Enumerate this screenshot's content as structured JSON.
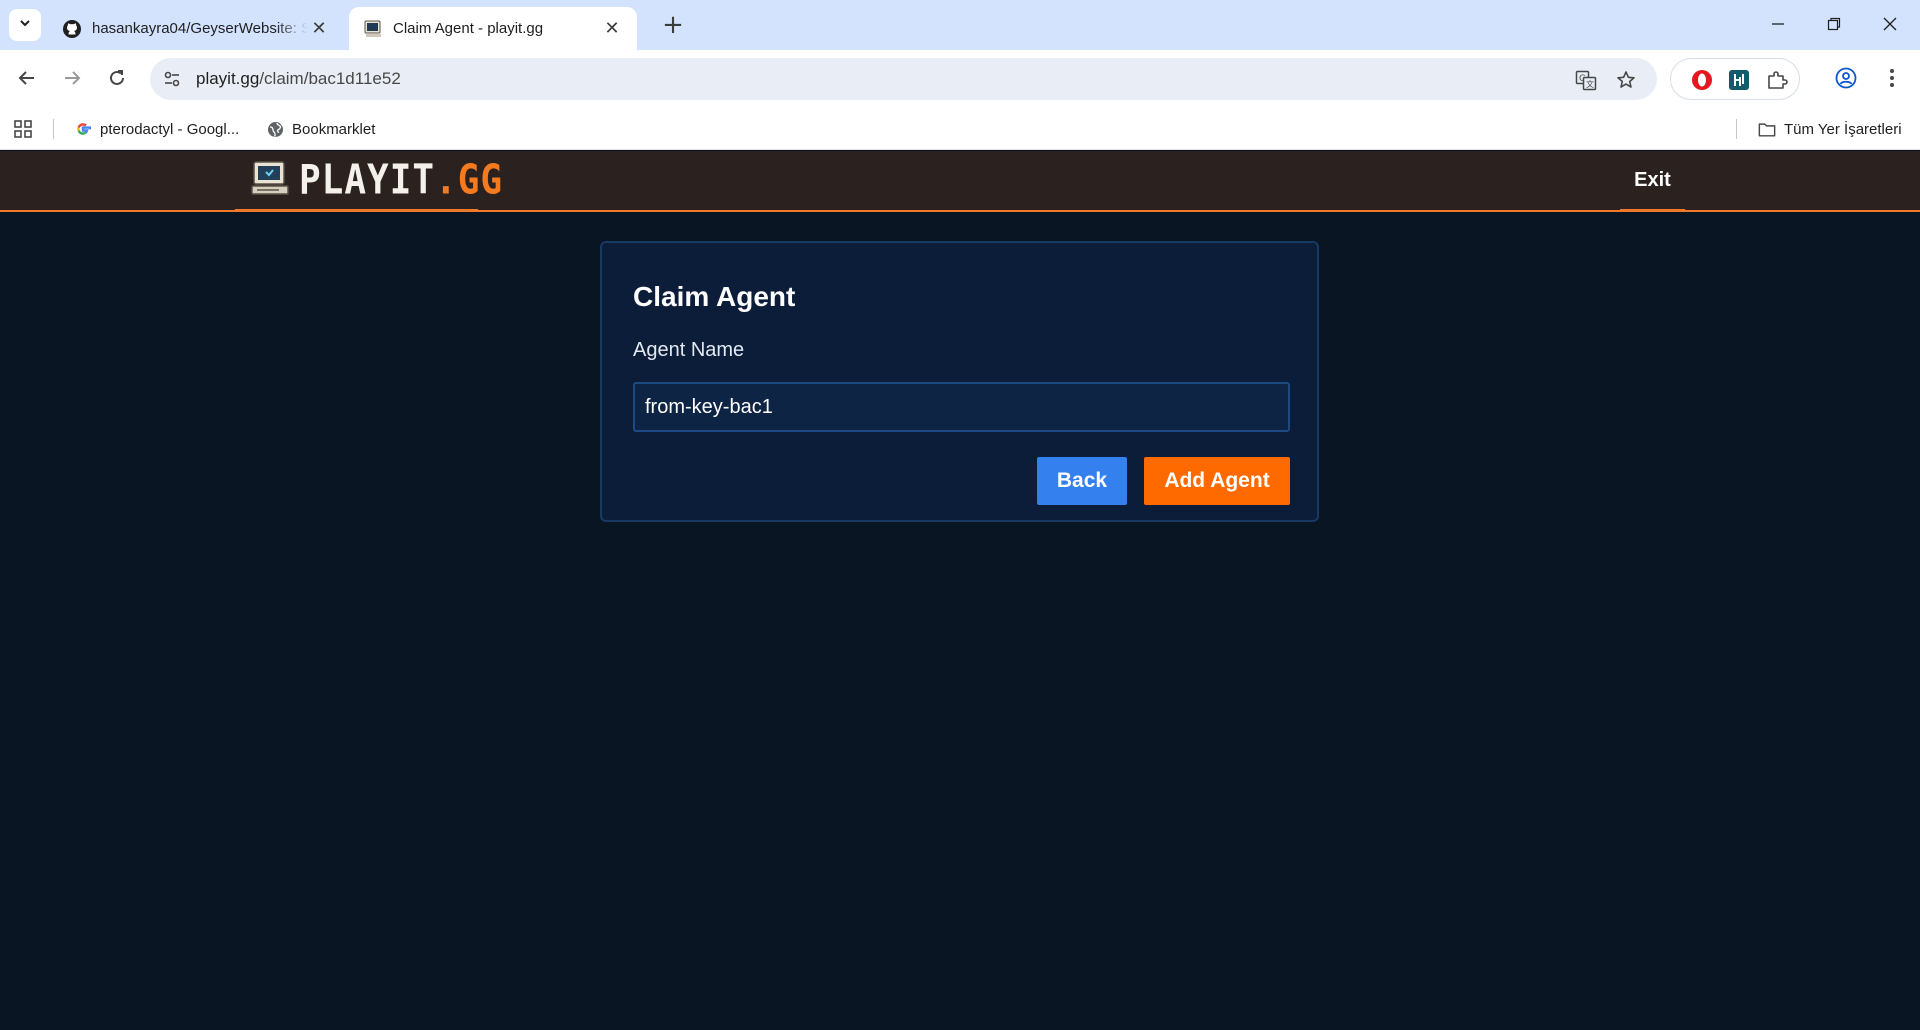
{
  "browser": {
    "tabs": [
      {
        "title": "hasankayra04/GeyserWebsite: S",
        "favicon": "github-icon",
        "active": false
      },
      {
        "title": "Claim Agent - playit.gg",
        "favicon": "playit-icon",
        "active": true
      }
    ],
    "url_host": "playit.gg",
    "url_path": "/claim/bac1d11e52",
    "bookmarks": [
      {
        "label": "pterodactyl - Googl...",
        "icon": "google-icon"
      },
      {
        "label": "Bookmarklet",
        "icon": "globe-icon"
      }
    ],
    "all_bookmarks_label": "Tüm Yer İşaretleri"
  },
  "site": {
    "logo_main": "PLAYIT",
    "logo_tld": ".GG",
    "exit_label": "Exit"
  },
  "card": {
    "title": "Claim Agent",
    "field_label": "Agent Name",
    "field_value": "from-key-bac1",
    "back_label": "Back",
    "add_label": "Add Agent"
  },
  "colors": {
    "header_bg": "#2b2220",
    "accent_orange": "#ff6a00",
    "back_blue": "#3480ee",
    "page_bg": "#0a1523",
    "card_bg": "#0b1d38"
  }
}
